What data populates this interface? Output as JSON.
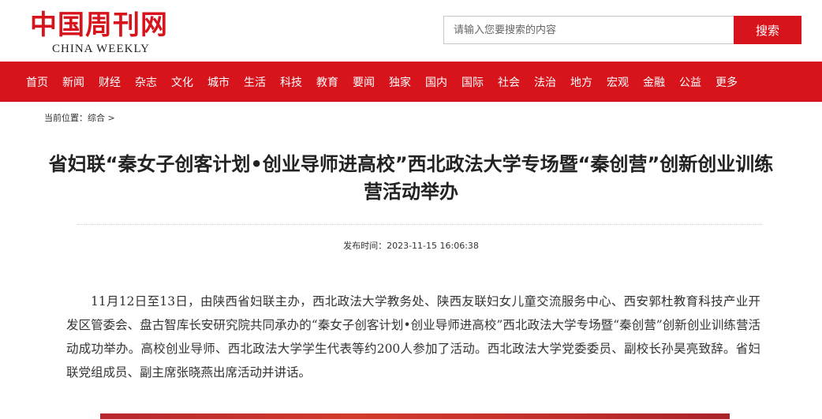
{
  "header": {
    "logo_cn": "中国周刊网",
    "logo_en": "CHINA WEEKLY",
    "search_placeholder": "请输入您要搜索的内容",
    "search_button": "搜索"
  },
  "nav": {
    "items": [
      "首页",
      "新闻",
      "财经",
      "杂志",
      "文化",
      "城市",
      "生活",
      "科技",
      "教育",
      "要闻",
      "独家",
      "国内",
      "国际",
      "社会",
      "法治",
      "地方",
      "宏观",
      "金融",
      "公益",
      "更多"
    ]
  },
  "breadcrumb": {
    "prefix": "当前位置：",
    "item": "综合",
    "separator": ">"
  },
  "article": {
    "title": "省妇联“秦女子创客计划•创业导师进高校”西北政法大学专场暨“秦创营”创新创业训练营活动举办",
    "pubtime": "发布时间：2023-11-15 16:06:38",
    "paragraph": "11月12日至13日，由陕西省妇联主办，西北政法大学教务处、陕西友联妇女儿童交流服务中心、西安郭杜教育科技产业开发区管委会、盘古智库长安研究院共同承办的“秦女子创客计划•创业导师进高校”西北政法大学专场暨“秦创营”创新创业训练营活动成功举办。高校创业导师、西北政法大学学生代表等约200人参加了活动。西北政法大学党委委员、副校长孙昊亮致辞。省妇联党组成员、副主席张晓燕出席活动并讲话。"
  },
  "colors": {
    "brand_red": "#d7141c"
  }
}
